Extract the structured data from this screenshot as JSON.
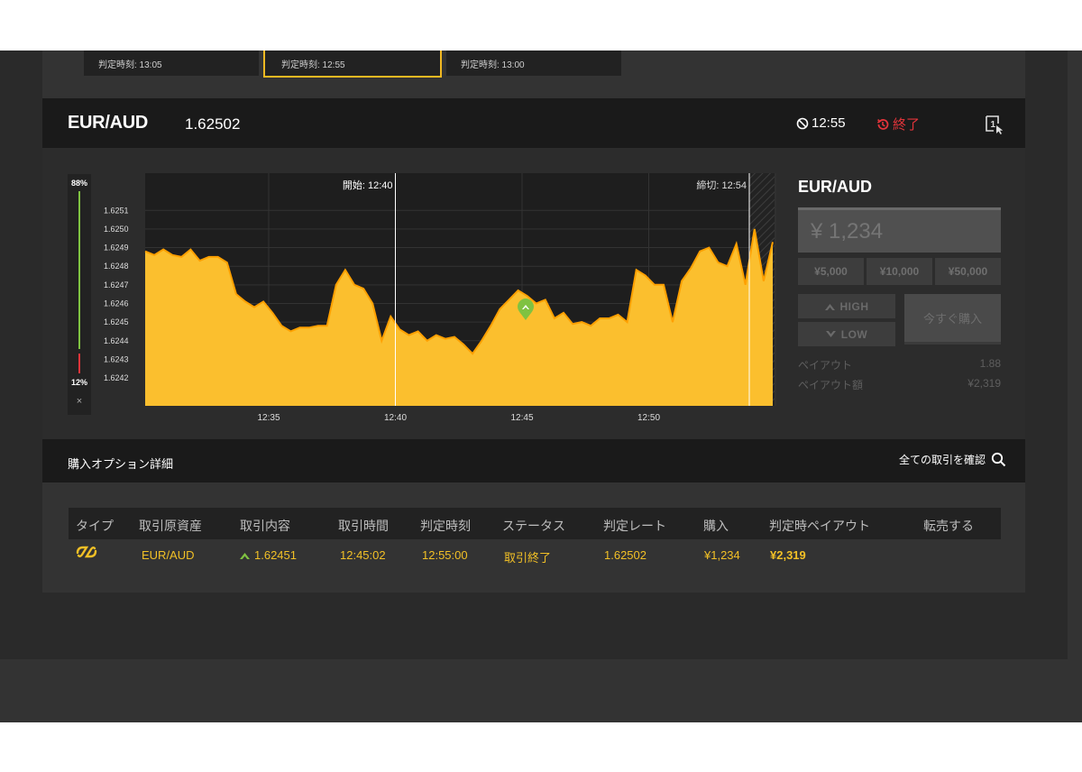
{
  "top_cards": [
    {
      "label": "判定時刻: 13:05"
    },
    {
      "label": "判定時刻: 12:55"
    },
    {
      "label": "判定時刻: 13:00"
    }
  ],
  "asset": {
    "name": "EUR/AUD",
    "rate": "1.62502",
    "expiry_time": "12:55",
    "status": "終了",
    "window_icon_label": "1"
  },
  "sentiment": {
    "high_pct": "88%",
    "low_pct": "12%",
    "close_label": "×"
  },
  "chart_data": {
    "type": "area",
    "y_ticks": [
      "1.6251",
      "1.6250",
      "1.6249",
      "1.6248",
      "1.6247",
      "1.6246",
      "1.6245",
      "1.6244",
      "1.6243",
      "1.6242"
    ],
    "x_ticks": [
      "12:35",
      "12:40",
      "12:45",
      "12:50"
    ],
    "ylim": [
      1.62405,
      1.6253
    ],
    "start_label": "開始: 12:40",
    "close_label": "締切: 12:54",
    "entry_rate": 1.62451,
    "series": [
      {
        "values": [
          1.62488,
          1.62486,
          1.62489,
          1.62486,
          1.62485,
          1.62489,
          1.62483,
          1.62485,
          1.62485,
          1.62482,
          1.62465,
          1.62461,
          1.62458,
          1.62461,
          1.62455,
          1.62448,
          1.62445,
          1.62447,
          1.62447,
          1.62448,
          1.62448,
          1.6247,
          1.62478,
          1.6247,
          1.62468,
          1.6246,
          1.6244,
          1.62453,
          1.62446,
          1.62443,
          1.62445,
          1.6244,
          1.62443,
          1.62441,
          1.62442,
          1.62438,
          1.62433,
          1.6244,
          1.62448,
          1.62457,
          1.62462,
          1.62467,
          1.62464,
          1.6246,
          1.62462,
          1.62452,
          1.62455,
          1.62449,
          1.6245,
          1.62448,
          1.62452,
          1.62452,
          1.62454,
          1.6245,
          1.62478,
          1.62475,
          1.6247,
          1.6247,
          1.6245,
          1.62472,
          1.62479,
          1.62488,
          1.6249,
          1.62482,
          1.6248,
          1.62492,
          1.6247,
          1.625,
          1.62472,
          1.62493
        ]
      }
    ]
  },
  "trade": {
    "title": "EUR/AUD",
    "amount_placeholder": "¥ 1,234",
    "presets": [
      "¥5,000",
      "¥10,000",
      "¥50,000"
    ],
    "high_label": "HIGH",
    "low_label": "LOW",
    "buy_label": "今すぐ購入",
    "payout_label": "ペイアウト",
    "payout_value": "1.88",
    "payout_amount_label": "ペイアウト額",
    "payout_amount_value": "¥2,319"
  },
  "details": {
    "title": "購入オプション詳細",
    "view_all": "全ての取引を確認"
  },
  "table": {
    "headers": [
      "タイプ",
      "取引原資産",
      "取引内容",
      "取引時間",
      "判定時刻",
      "ステータス",
      "判定レート",
      "購入",
      "判定時ペイアウト",
      "転売する"
    ],
    "row": {
      "asset": "EUR/AUD",
      "content": "1.62451",
      "trade_time": "12:45:02",
      "expiry": "12:55:00",
      "status": "取引終了",
      "expiry_rate": "1.62502",
      "purchase": "¥1,234",
      "payout": "¥2,319"
    }
  },
  "colors": {
    "accent": "#f2b922",
    "area_fill": "#fbbf2e",
    "line": "#ffa000",
    "green": "#7fc241",
    "red": "#e2343a"
  }
}
